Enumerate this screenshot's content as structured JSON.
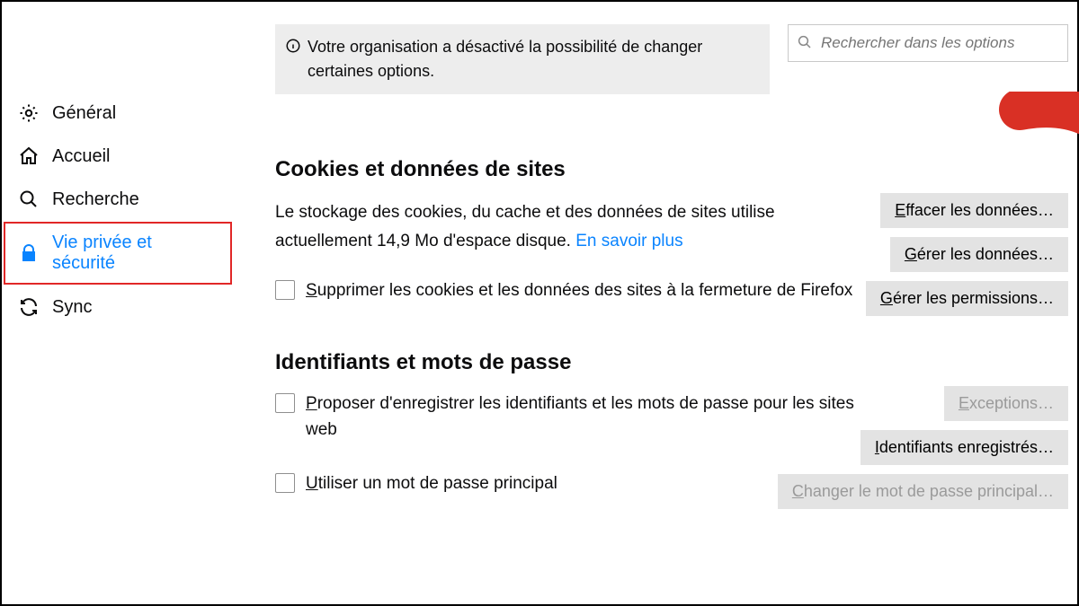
{
  "banner_text": "Votre organisation a désactivé la possibilité de changer certaines options.",
  "search_placeholder": "Rechercher dans les options",
  "sidebar": {
    "items": [
      {
        "label": "Général"
      },
      {
        "label": "Accueil"
      },
      {
        "label": "Recherche"
      },
      {
        "label": "Vie privée et sécurité"
      },
      {
        "label": "Sync"
      }
    ]
  },
  "cookies": {
    "title": "Cookies et données de sites",
    "desc_prefix": "Le stockage des cookies, du cache et des données de sites utilise actuellement ",
    "size": "14,9 Mo",
    "desc_suffix": " d'espace disque.  ",
    "learn_more": "En savoir plus",
    "checkbox_label_pre": "S",
    "checkbox_label_rest": "upprimer les cookies et les données des sites à la fermeture de Firefox",
    "btn_clear_pre": "E",
    "btn_clear_rest": "ffacer les données…",
    "btn_manage_pre": "G",
    "btn_manage_rest": "érer les données…",
    "btn_perm_pre": "G",
    "btn_perm_rest": "érer les permissions…"
  },
  "logins": {
    "title": "Identifiants et mots de passe",
    "row1_pre": "P",
    "row1_rest": "roposer d'enregistrer les identifiants et les mots de passe pour les sites web",
    "row2_pre": "U",
    "row2_rest": "tiliser un mot de passe principal",
    "btn_exc_pre": "E",
    "btn_exc_rest": "xceptions…",
    "btn_saved_pre": "I",
    "btn_saved_rest": "dentifiants enregistrés…",
    "btn_change_pre": "C",
    "btn_change_rest": "hanger le mot de passe principal…"
  }
}
